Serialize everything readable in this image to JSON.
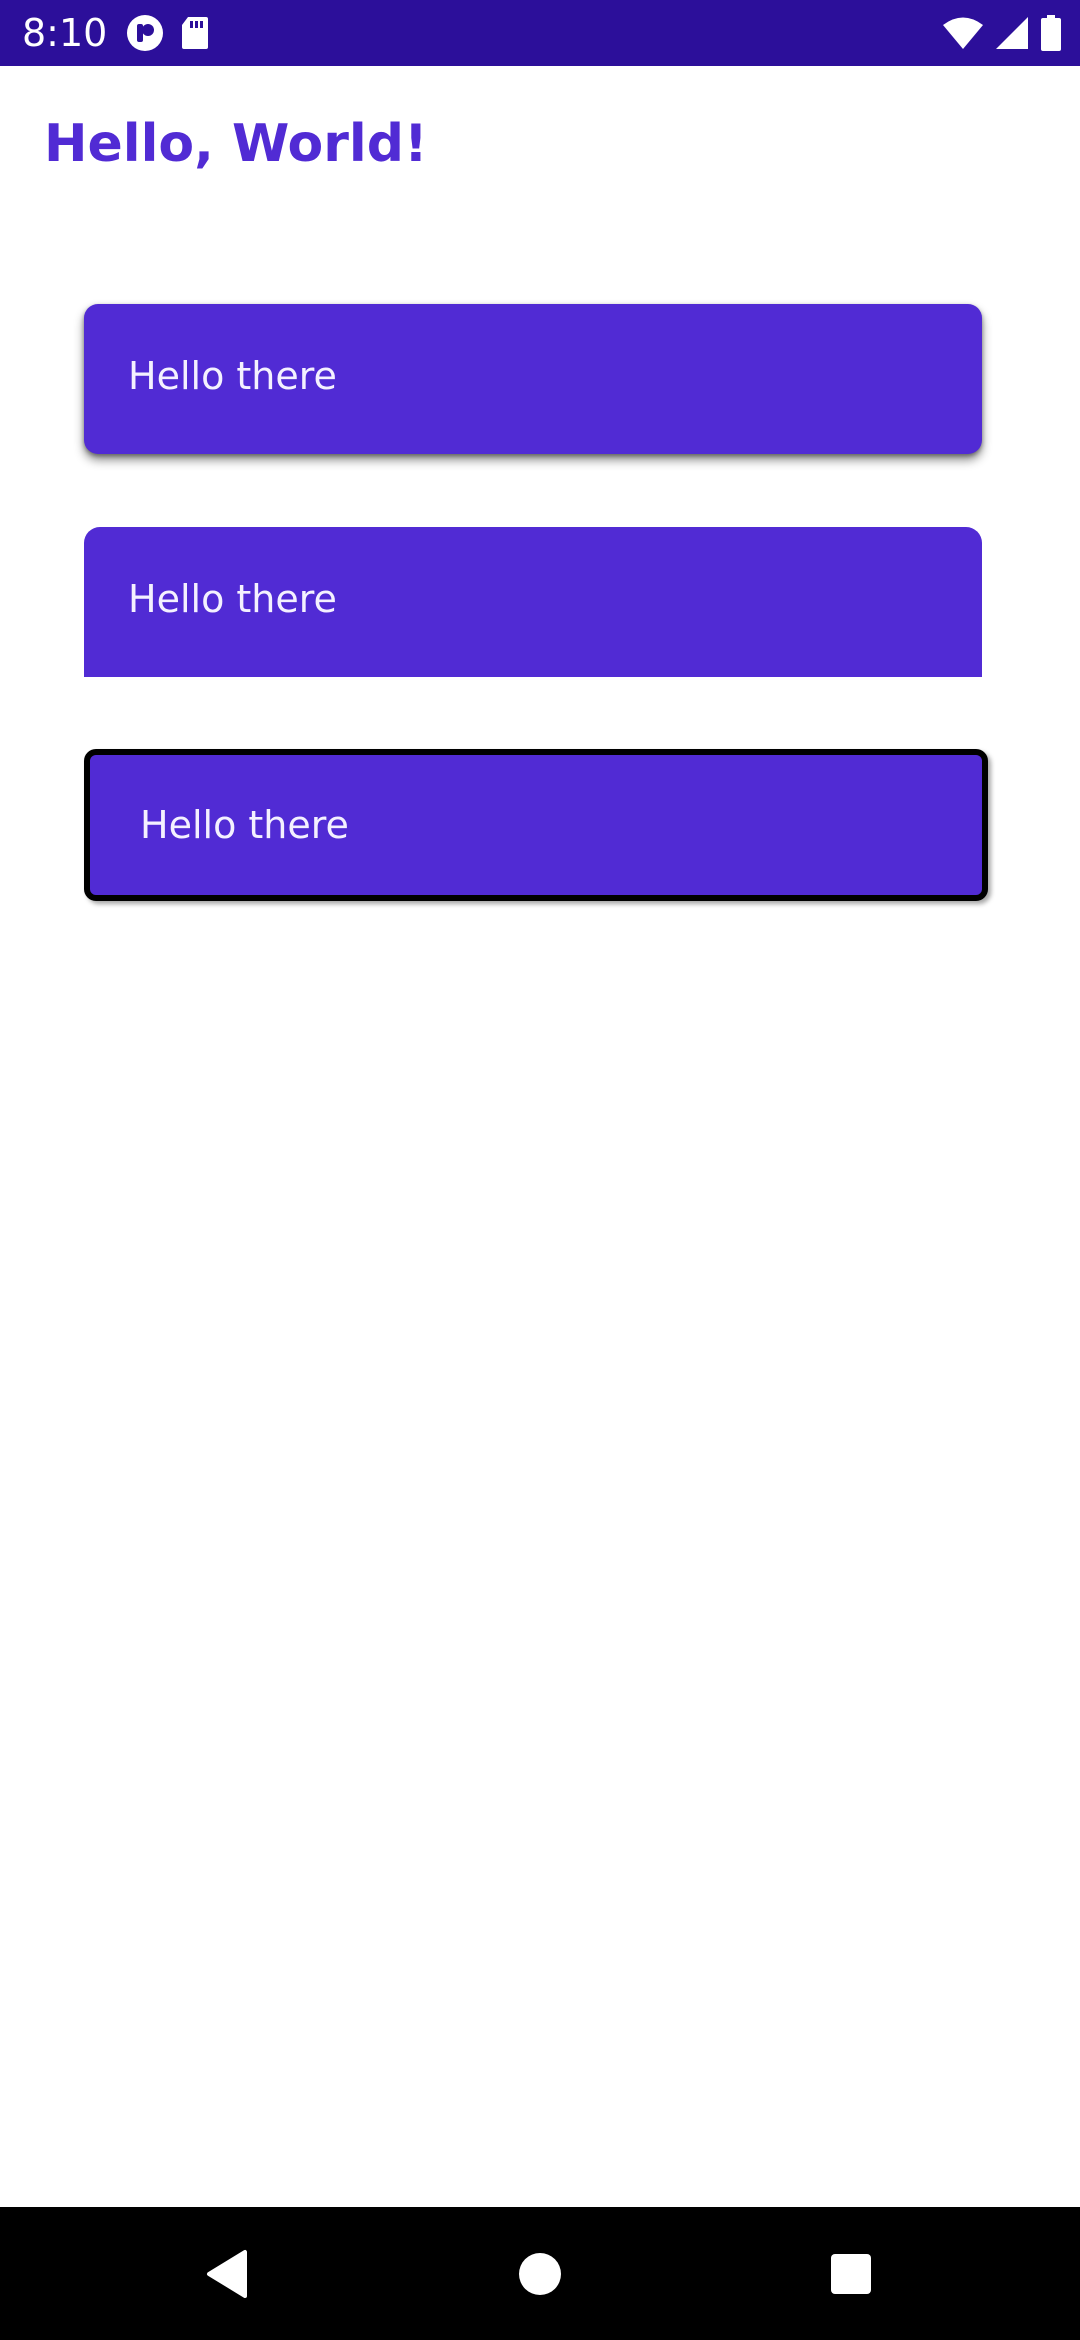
{
  "status_bar": {
    "time": "8:10",
    "left_icons": [
      "notification-app-icon",
      "sd-card-icon"
    ],
    "right_icons": [
      "wifi-icon",
      "cellular-signal-icon",
      "battery-icon"
    ],
    "background": "#2c0f9a"
  },
  "page": {
    "title": "Hello, World!",
    "title_color": "#512bd4"
  },
  "cards": [
    {
      "label": "Hello there",
      "style": "shadow"
    },
    {
      "label": "Hello there",
      "style": "flat"
    },
    {
      "label": "Hello there",
      "style": "bordered"
    }
  ],
  "accent_color": "#512bd4",
  "nav_bar": {
    "buttons": [
      "back-icon",
      "home-icon",
      "recents-icon"
    ]
  }
}
